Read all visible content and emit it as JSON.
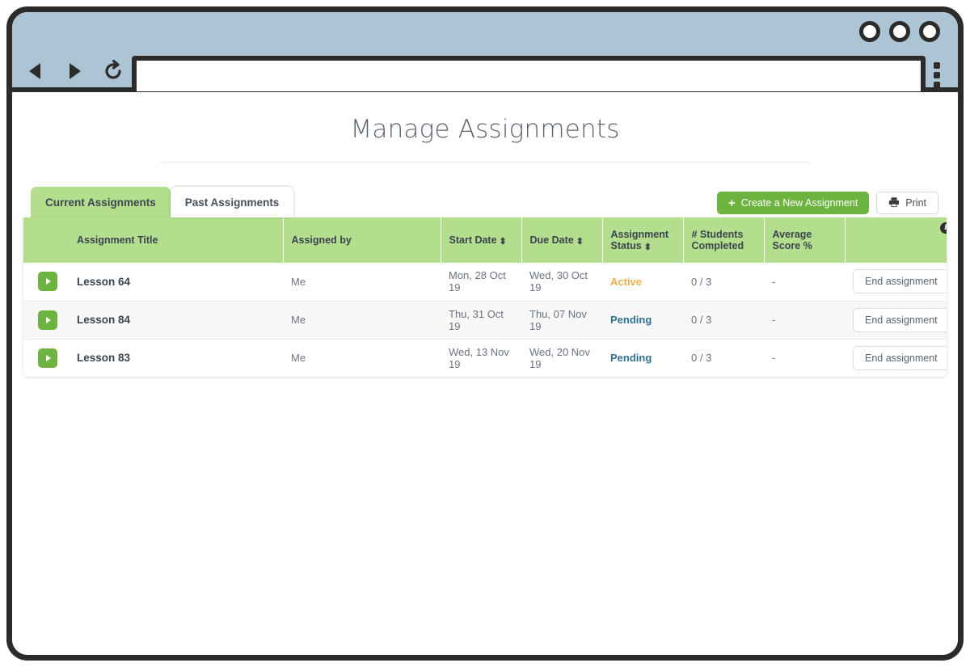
{
  "browser": {
    "url_value": "",
    "url_placeholder": "",
    "back_label": "◀",
    "forward_label": "▶",
    "reload_label": "↻",
    "window_buttons": [
      "minimize",
      "maximize",
      "close"
    ],
    "menu_label": "browser-menu"
  },
  "page": {
    "title": "Manage Assignments"
  },
  "tabs": [
    {
      "label": "Current Assignments",
      "active": true
    },
    {
      "label": "Past Assignments",
      "active": false
    }
  ],
  "toolbar": {
    "create_label": "Create a New Assignment",
    "create_icon": "plus-icon",
    "create_color": "#6cb33f",
    "print_label": "Print",
    "print_icon": "printer-icon"
  },
  "table": {
    "header_color": "#b3de8e",
    "info_badge": "i",
    "columns": [
      {
        "label": "",
        "sortable": false
      },
      {
        "label": "Assignment Title",
        "sortable": false
      },
      {
        "label": "Assigned by",
        "sortable": false
      },
      {
        "label": "Start Date",
        "sortable": true
      },
      {
        "label": "Due Date",
        "sortable": true
      },
      {
        "label": "Assignment Status",
        "sortable": true
      },
      {
        "label": "# Students Completed",
        "sortable": false
      },
      {
        "label": "Average Score %",
        "sortable": false
      },
      {
        "label": "",
        "sortable": false
      }
    ],
    "sort_icon": "⬍",
    "rows": [
      {
        "expand_icon": "expand-arrow-icon",
        "title": "Lesson 64",
        "assigned_by": "Me",
        "start_date": "Mon, 28 Oct 19",
        "due_date": "Wed, 30 Oct 19",
        "status": "Active",
        "status_color": "#f0ad4e",
        "students_completed": "0 / 3",
        "average_score": "-",
        "action_label": "End assignment"
      },
      {
        "expand_icon": "expand-arrow-icon",
        "title": "Lesson 84",
        "assigned_by": "Me",
        "start_date": "Thu, 31 Oct 19",
        "due_date": "Thu, 07 Nov 19",
        "status": "Pending",
        "status_color": "#31708f",
        "students_completed": "0 / 3",
        "average_score": "-",
        "action_label": "End assignment"
      },
      {
        "expand_icon": "expand-arrow-icon",
        "title": "Lesson 83",
        "assigned_by": "Me",
        "start_date": "Wed, 13 Nov 19",
        "due_date": "Wed, 20 Nov 19",
        "status": "Pending",
        "status_color": "#31708f",
        "students_completed": "0 / 3",
        "average_score": "-",
        "action_label": "End assignment"
      }
    ]
  }
}
